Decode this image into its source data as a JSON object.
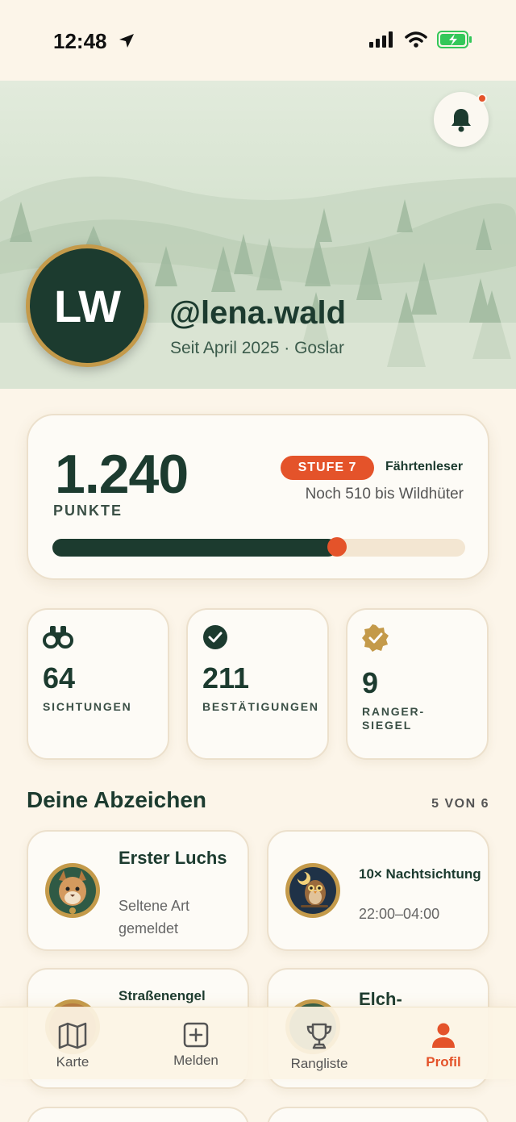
{
  "status_bar": {
    "time": "12:48",
    "icons": [
      "location-arrow-icon",
      "signal-icon",
      "wifi-icon",
      "battery-charging-icon"
    ]
  },
  "colors": {
    "primary": "#1c3b2f",
    "accent": "#e4532a",
    "gold": "#c49a4a",
    "background": "#fcf5e9"
  },
  "profile": {
    "initials": "LW",
    "username": "@lena.wald",
    "since": "Seit April 2025 · Goslar",
    "notifications_unread": true
  },
  "points": {
    "value": "1.240",
    "label": "PUNKTE",
    "level_badge": "STUFE 7",
    "level_name": "Fährtenleser",
    "next_level": "Noch 510 bis Wildhüter",
    "progress_fraction": 0.69
  },
  "stats": [
    {
      "value": "64",
      "label": "SICHTUNGEN",
      "icon": "binoculars-icon"
    },
    {
      "value": "211",
      "label": "BESTÄTIGUNGEN",
      "icon": "check-circle-icon"
    },
    {
      "value": "9",
      "label": "RANGER-SIEGEL",
      "icon": "seal-badge-icon"
    }
  ],
  "badges": {
    "title": "Deine Abzeichen",
    "count": "5 VON 6",
    "items": [
      {
        "title": "Erster Luchs",
        "subtitle": "Seltene Art gemeldet",
        "icon": "lynx-icon"
      },
      {
        "title": "10× Nachtsichtung",
        "subtitle": "22:00–04:00",
        "icon": "owl-icon"
      },
      {
        "title": "Straßenengel",
        "subtitle": "",
        "icon": "road-badge-icon"
      },
      {
        "title": "Elch-",
        "subtitle": "",
        "icon": "elk-badge-icon"
      }
    ]
  },
  "tabbar": {
    "items": [
      {
        "label": "Karte",
        "icon": "map-icon",
        "active": false
      },
      {
        "label": "Melden",
        "icon": "plus-square-icon",
        "active": false
      },
      {
        "label": "Rangliste",
        "icon": "trophy-icon",
        "active": false
      },
      {
        "label": "Profil",
        "icon": "person-icon",
        "active": true
      }
    ]
  }
}
